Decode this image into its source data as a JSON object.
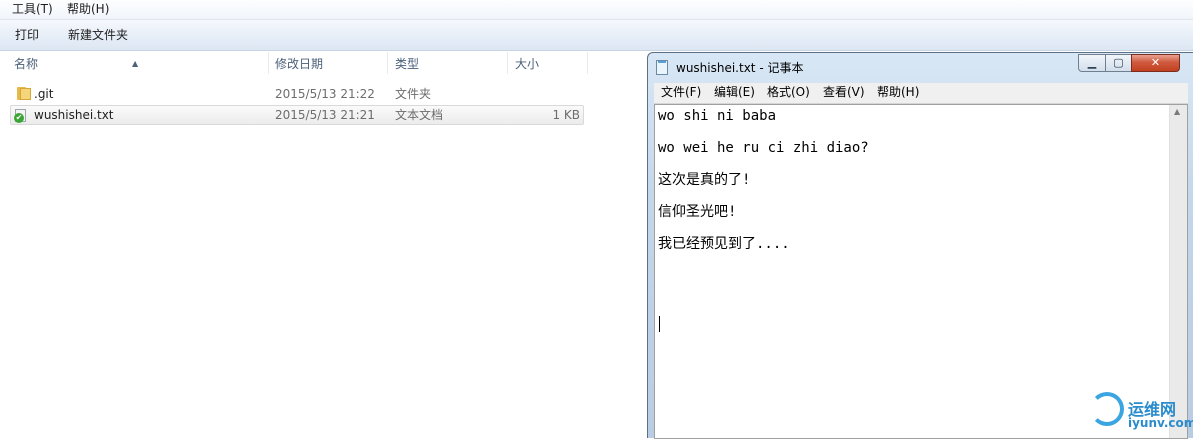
{
  "explorer": {
    "menu": [
      "工具(T)",
      "帮助(H)"
    ],
    "toolbar": [
      "打印",
      "新建文件夹"
    ],
    "columns": {
      "name": "名称",
      "date": "修改日期",
      "type": "类型",
      "size": "大小"
    },
    "files": [
      {
        "name": ".git",
        "date": "2015/5/13 21:22",
        "type": "文件夹",
        "size": "",
        "icon": "folder-icon"
      },
      {
        "name": "wushishei.txt",
        "date": "2015/5/13 21:21",
        "type": "文本文档",
        "size": "1 KB",
        "icon": "text-file-icon"
      }
    ]
  },
  "notepad": {
    "title": "wushishei.txt - 记事本",
    "menu": [
      "文件(F)",
      "编辑(E)",
      "格式(O)",
      "查看(V)",
      "帮助(H)"
    ],
    "lines": [
      "wo shi ni baba",
      "wo wei he ru ci zhi diao?",
      "这次是真的了!",
      "信仰圣光吧!",
      "我已经预见到了...."
    ]
  },
  "watermark": {
    "cn": "运维网",
    "en": "iyunv.com"
  }
}
